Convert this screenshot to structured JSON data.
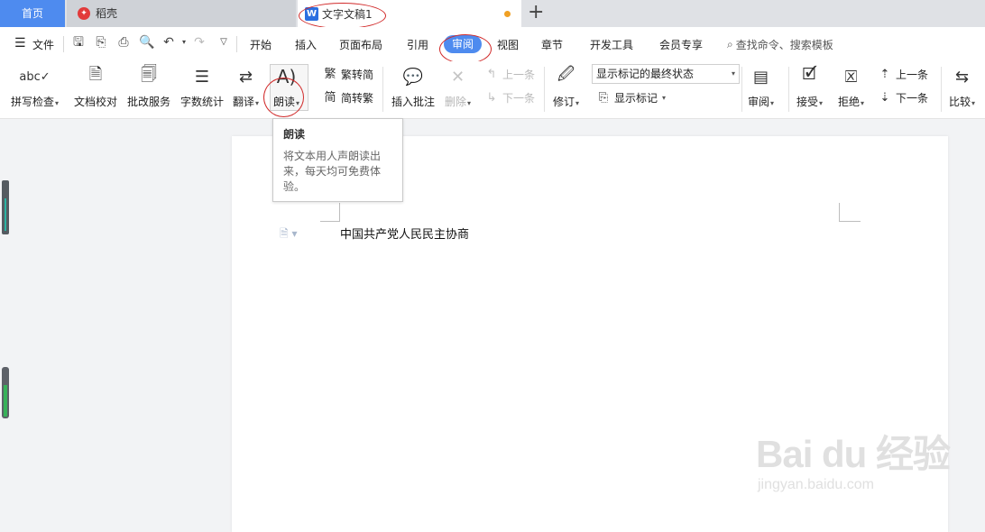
{
  "tabs": {
    "home": "首页",
    "daoke": "稻壳",
    "doc": "文字文稿1",
    "doc_icon": "W"
  },
  "menu": {
    "file": "文件",
    "items": [
      "开始",
      "插入",
      "页面布局",
      "引用",
      "审阅",
      "视图",
      "章节",
      "开发工具",
      "会员专享"
    ],
    "search": "查找命令、搜索模板"
  },
  "ribbon": {
    "spell_check": "拼写检查",
    "doc_proofread": "文档校对",
    "revision_service": "批改服务",
    "word_count": "字数统计",
    "translate": "翻译",
    "read_aloud": "朗读",
    "trad_to_simp": "繁转简",
    "simp_to_trad": "简转繁",
    "insert_comment": "插入批注",
    "delete": "删除",
    "prev": "上一条",
    "next": "下一条",
    "track_changes": "修订",
    "display_state": "显示标记的最终状态",
    "show_markup": "显示标记",
    "review": "审阅",
    "accept": "接受",
    "reject": "拒绝",
    "prev2": "上一条",
    "next2": "下一条",
    "compare": "比较"
  },
  "tooltip": {
    "title": "朗读",
    "body": "将文本用人声朗读出来，每天均可免费体验。"
  },
  "document": {
    "text": "中国共产党人民民主协商"
  },
  "watermark": {
    "main": "Bai du 经验",
    "sub": "jingyan.baidu.com"
  },
  "colors": {
    "accent": "#4e8bef",
    "annotation": "#d12a2a",
    "unsaved_dot": "#f0a024"
  }
}
